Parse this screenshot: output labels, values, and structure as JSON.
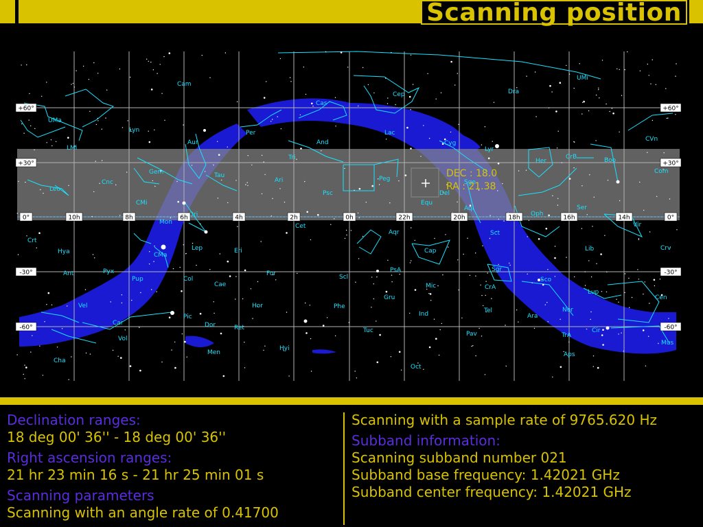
{
  "title": "Scanning position",
  "colors": {
    "accent": "#d9c300",
    "header": "#5a2de0",
    "milky_way": "#1a1ad2",
    "grid": "#b4b4b4",
    "constellation": "#19e2ff"
  },
  "map": {
    "dec_labels": [
      "+60°",
      "+30°",
      "0°",
      "-30°",
      "-60°"
    ],
    "ra_labels": [
      "10h",
      "8h",
      "6h",
      "4h",
      "2h",
      "0h",
      "22h",
      "20h",
      "18h",
      "16h",
      "14h"
    ],
    "cursor": {
      "dec_text": "DEC : 18.0",
      "ra_text": "RA : 21.38"
    },
    "constellations": [
      "Cam",
      "UMa",
      "Lyn",
      "LMi",
      "Leo",
      "Cnc",
      "Gem",
      "CMi",
      "Mon",
      "Ori",
      "Tau",
      "Aur",
      "Per",
      "Cas",
      "And",
      "Tri",
      "Ari",
      "Psc",
      "Peg",
      "Equ",
      "Del",
      "Sge",
      "Lac",
      "Cep",
      "Dra",
      "UMi",
      "Cyg",
      "Lyr",
      "Her",
      "CrB",
      "Boo",
      "CVn",
      "Com",
      "Ser",
      "Oph",
      "Aql",
      "Sct",
      "Vir",
      "Lib",
      "Crv",
      "Crt",
      "Hya",
      "Ant",
      "Pyx",
      "Pup",
      "CMa",
      "Lep",
      "Eri",
      "Cet",
      "Aqr",
      "Cap",
      "Sgr",
      "Sco",
      "CrA",
      "Lup",
      "Cen",
      "Nor",
      "Ara",
      "Tel",
      "Ind",
      "Pav",
      "TrA",
      "Cir",
      "Mus",
      "Aps",
      "Oct",
      "Tuc",
      "Hyi",
      "Men",
      "Dor",
      "Ret",
      "Pic",
      "Col",
      "Cae",
      "Hor",
      "For",
      "Scl",
      "Phe",
      "Gru",
      "PsA",
      "Mic",
      "Vel",
      "Car",
      "Vol",
      "Cha"
    ]
  },
  "info_left": {
    "dec_header": "Declination ranges:",
    "dec_value": "18 deg 00' 36'' - 18 deg 00' 36''",
    "ra_header": "Right ascension ranges:",
    "ra_value": "21 hr 23 min 16 s - 21 hr 25 min 01 s",
    "params_header": "Scanning parameters",
    "params_value": "Scanning with an angle rate of 0.41700"
  },
  "info_right": {
    "sample_rate": "Scanning with a sample rate of 9765.620 Hz",
    "subband_header": "Subband information:",
    "subband_number": "Scanning subband number 021",
    "base_freq": "Subband base frequency: 1.42021 GHz",
    "center_freq": "Subband center frequency: 1.42021 GHz"
  }
}
